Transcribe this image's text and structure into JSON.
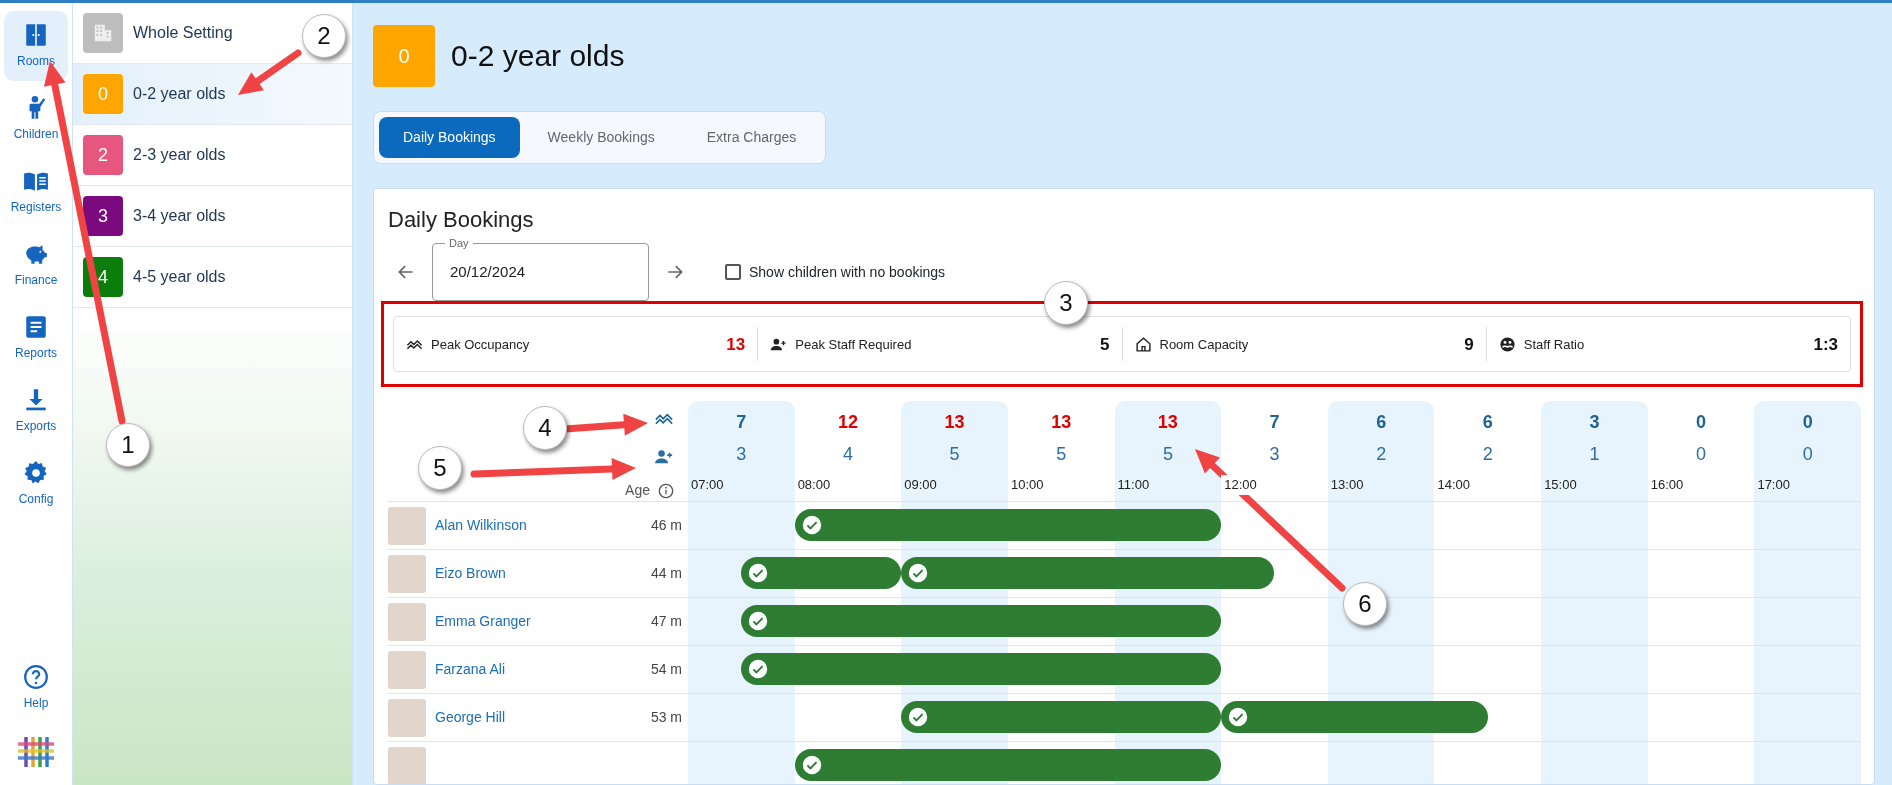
{
  "nav_rail": {
    "items": [
      {
        "label": "Rooms",
        "selected": true
      },
      {
        "label": "Children",
        "selected": false
      },
      {
        "label": "Registers",
        "selected": false
      },
      {
        "label": "Finance",
        "selected": false
      },
      {
        "label": "Reports",
        "selected": false
      },
      {
        "label": "Exports",
        "selected": false
      },
      {
        "label": "Config",
        "selected": false
      }
    ],
    "help": {
      "label": "Help"
    }
  },
  "rooms_list": {
    "items": [
      {
        "kind": "all",
        "label": "Whole Setting",
        "selected": false
      },
      {
        "kind": "room",
        "badge": "0",
        "label": "0-2 year olds",
        "color": "#ffa500",
        "selected": true
      },
      {
        "kind": "room",
        "badge": "2",
        "label": "2-3 year olds",
        "color": "#e6567e",
        "selected": false
      },
      {
        "kind": "room",
        "badge": "3",
        "label": "3-4 year olds",
        "color": "#7b0a7f",
        "selected": false
      },
      {
        "kind": "room",
        "badge": "4",
        "label": "4-5 year olds",
        "color": "#0a7d0a",
        "selected": false
      }
    ]
  },
  "header": {
    "badge": "0",
    "title": "0-2 year olds",
    "color": "#ffa500"
  },
  "tabs": [
    {
      "label": "Daily Bookings",
      "selected": true
    },
    {
      "label": "Weekly Bookings",
      "selected": false
    },
    {
      "label": "Extra Charges",
      "selected": false
    }
  ],
  "card": {
    "title": "Daily Bookings",
    "day_field": {
      "label": "Day",
      "value": "20/12/2024"
    },
    "checkbox": {
      "label": "Show children with no bookings",
      "checked": false
    },
    "stats": [
      {
        "label": "Peak Occupancy",
        "value": "13",
        "alert": true
      },
      {
        "label": "Peak Staff Required",
        "value": "5",
        "alert": false
      },
      {
        "label": "Room Capacity",
        "value": "9",
        "alert": false
      },
      {
        "label": "Staff Ratio",
        "value": "1:3",
        "alert": false
      }
    ],
    "timeline": {
      "age_label": "Age",
      "columns": [
        {
          "peak": "7",
          "staff": "3",
          "time": "07:00",
          "alert": false
        },
        {
          "peak": "12",
          "staff": "4",
          "time": "08:00",
          "alert": true
        },
        {
          "peak": "13",
          "staff": "5",
          "time": "09:00",
          "alert": true
        },
        {
          "peak": "13",
          "staff": "5",
          "time": "10:00",
          "alert": true
        },
        {
          "peak": "13",
          "staff": "5",
          "time": "11:00",
          "alert": true
        },
        {
          "peak": "7",
          "staff": "3",
          "time": "12:00",
          "alert": false
        },
        {
          "peak": "6",
          "staff": "2",
          "time": "13:00",
          "alert": false
        },
        {
          "peak": "6",
          "staff": "2",
          "time": "14:00",
          "alert": false
        },
        {
          "peak": "3",
          "staff": "1",
          "time": "15:00",
          "alert": false
        },
        {
          "peak": "0",
          "staff": "0",
          "time": "16:00",
          "alert": false
        },
        {
          "peak": "0",
          "staff": "0",
          "time": "17:00",
          "alert": false
        }
      ],
      "rows": [
        {
          "name": "Alan Wilkinson",
          "age": "46 m",
          "half_hours": [
            {
              "kind": "free"
            },
            {
              "kind": "free"
            },
            {
              "kind": "start"
            },
            {
              "kind": "booked"
            },
            {
              "kind": "booked"
            },
            {
              "kind": "booked"
            },
            {
              "kind": "booked"
            },
            {
              "kind": "booked"
            },
            {
              "kind": "booked"
            },
            {
              "kind": "booked"
            },
            {
              "kind": "free"
            },
            {
              "kind": "free"
            },
            {
              "kind": "free"
            },
            {
              "kind": "free"
            },
            {
              "kind": "free"
            },
            {
              "kind": "free"
            },
            {
              "kind": "free"
            },
            {
              "kind": "free"
            },
            {
              "kind": "free"
            },
            {
              "kind": "free"
            },
            {
              "kind": "free"
            },
            {
              "kind": "free"
            }
          ]
        },
        {
          "name": "Eizo Brown",
          "age": "44 m",
          "half_hours": [
            {
              "kind": "free"
            },
            {
              "kind": "start"
            },
            {
              "kind": "booked"
            },
            {
              "kind": "booked"
            },
            {
              "kind": "start"
            },
            {
              "kind": "booked"
            },
            {
              "kind": "booked"
            },
            {
              "kind": "booked"
            },
            {
              "kind": "booked"
            },
            {
              "kind": "booked"
            },
            {
              "kind": "booked"
            },
            {
              "kind": "free"
            },
            {
              "kind": "free"
            },
            {
              "kind": "free"
            },
            {
              "kind": "free"
            },
            {
              "kind": "free"
            },
            {
              "kind": "free"
            },
            {
              "kind": "free"
            },
            {
              "kind": "free"
            },
            {
              "kind": "free"
            },
            {
              "kind": "free"
            },
            {
              "kind": "free"
            }
          ]
        },
        {
          "name": "Emma Granger",
          "age": "47 m",
          "half_hours": [
            {
              "kind": "free"
            },
            {
              "kind": "start"
            },
            {
              "kind": "booked"
            },
            {
              "kind": "booked"
            },
            {
              "kind": "booked"
            },
            {
              "kind": "booked"
            },
            {
              "kind": "booked"
            },
            {
              "kind": "booked"
            },
            {
              "kind": "booked"
            },
            {
              "kind": "booked"
            },
            {
              "kind": "free"
            },
            {
              "kind": "free"
            },
            {
              "kind": "free"
            },
            {
              "kind": "free"
            },
            {
              "kind": "free"
            },
            {
              "kind": "free"
            },
            {
              "kind": "free"
            },
            {
              "kind": "free"
            },
            {
              "kind": "free"
            },
            {
              "kind": "free"
            },
            {
              "kind": "free"
            },
            {
              "kind": "free"
            }
          ]
        },
        {
          "name": "Farzana Ali",
          "age": "54 m",
          "half_hours": [
            {
              "kind": "free"
            },
            {
              "kind": "start"
            },
            {
              "kind": "booked"
            },
            {
              "kind": "booked"
            },
            {
              "kind": "booked"
            },
            {
              "kind": "booked"
            },
            {
              "kind": "booked"
            },
            {
              "kind": "booked"
            },
            {
              "kind": "booked"
            },
            {
              "kind": "booked"
            },
            {
              "kind": "free"
            },
            {
              "kind": "free"
            },
            {
              "kind": "free"
            },
            {
              "kind": "free"
            },
            {
              "kind": "free"
            },
            {
              "kind": "free"
            },
            {
              "kind": "free"
            },
            {
              "kind": "free"
            },
            {
              "kind": "free"
            },
            {
              "kind": "free"
            },
            {
              "kind": "free"
            },
            {
              "kind": "free"
            }
          ]
        },
        {
          "name": "George Hill",
          "age": "53 m",
          "half_hours": [
            {
              "kind": "free"
            },
            {
              "kind": "free"
            },
            {
              "kind": "free"
            },
            {
              "kind": "free"
            },
            {
              "kind": "start"
            },
            {
              "kind": "booked"
            },
            {
              "kind": "booked"
            },
            {
              "kind": "booked"
            },
            {
              "kind": "booked"
            },
            {
              "kind": "booked"
            },
            {
              "kind": "start"
            },
            {
              "kind": "booked"
            },
            {
              "kind": "booked"
            },
            {
              "kind": "booked"
            },
            {
              "kind": "booked"
            },
            {
              "kind": "free"
            },
            {
              "kind": "free"
            },
            {
              "kind": "free"
            },
            {
              "kind": "free"
            },
            {
              "kind": "free"
            },
            {
              "kind": "free"
            },
            {
              "kind": "free"
            }
          ]
        },
        {
          "half_hours": [
            {
              "kind": "free"
            },
            {
              "kind": "free"
            },
            {
              "kind": "start"
            },
            {
              "kind": "booked"
            },
            {
              "kind": "booked"
            },
            {
              "kind": "booked"
            },
            {
              "kind": "booked"
            },
            {
              "kind": "booked"
            },
            {
              "kind": "booked"
            },
            {
              "kind": "booked"
            },
            {
              "kind": "free"
            },
            {
              "kind": "free"
            },
            {
              "kind": "free"
            },
            {
              "kind": "free"
            },
            {
              "kind": "free"
            },
            {
              "kind": "free"
            },
            {
              "kind": "free"
            },
            {
              "kind": "free"
            },
            {
              "kind": "free"
            },
            {
              "kind": "free"
            },
            {
              "kind": "free"
            },
            {
              "kind": "free"
            }
          ]
        }
      ]
    }
  },
  "annotations": {
    "callouts": [
      "1",
      "2",
      "3",
      "4",
      "5",
      "6"
    ]
  }
}
